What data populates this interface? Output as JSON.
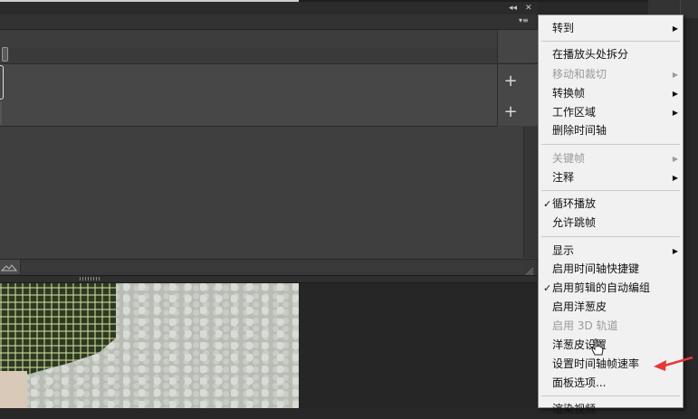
{
  "panel": {
    "header_icons": {
      "collapse": "double-chevron-icon",
      "close": "close-icon",
      "flyout": "panel-menu-icon"
    },
    "header_glyphs": {
      "collapse": "◂◂",
      "close": "✕",
      "flyout": "▾≡"
    },
    "tracks": [
      {
        "add_label": "+"
      },
      {
        "add_label": "+"
      }
    ]
  },
  "menu": {
    "items": [
      {
        "label": "转到",
        "submenu": true,
        "checked": false,
        "disabled": false
      },
      {
        "label": "在播放头处拆分",
        "submenu": false,
        "checked": false,
        "disabled": false
      },
      {
        "label": "移动和裁切",
        "submenu": true,
        "checked": false,
        "disabled": true
      },
      {
        "label": "转换帧",
        "submenu": true,
        "checked": false,
        "disabled": false
      },
      {
        "label": "工作区域",
        "submenu": true,
        "checked": false,
        "disabled": false
      },
      {
        "label": "删除时间轴",
        "submenu": false,
        "checked": false,
        "disabled": false
      },
      {
        "label": "关键帧",
        "submenu": true,
        "checked": false,
        "disabled": true
      },
      {
        "label": "注释",
        "submenu": true,
        "checked": false,
        "disabled": false
      },
      {
        "label": "循环播放",
        "submenu": false,
        "checked": true,
        "disabled": false
      },
      {
        "label": "允许跳帧",
        "submenu": false,
        "checked": false,
        "disabled": false
      },
      {
        "label": "显示",
        "submenu": true,
        "checked": false,
        "disabled": false
      },
      {
        "label": "启用时间轴快捷键",
        "submenu": false,
        "checked": false,
        "disabled": false
      },
      {
        "label": "启用剪辑的自动编组",
        "submenu": false,
        "checked": true,
        "disabled": false
      },
      {
        "label": "启用洋葱皮",
        "submenu": false,
        "checked": false,
        "disabled": false
      },
      {
        "label": "启用 3D 轨道",
        "submenu": false,
        "checked": false,
        "disabled": true
      },
      {
        "label": "洋葱皮设置",
        "submenu": false,
        "checked": false,
        "disabled": false
      },
      {
        "label": "设置时间轴帧速率",
        "submenu": false,
        "checked": false,
        "disabled": false
      },
      {
        "label": "面板选项...",
        "submenu": false,
        "checked": false,
        "disabled": false
      },
      {
        "label": "渲染视频",
        "submenu": false,
        "checked": false,
        "disabled": false
      }
    ],
    "check_glyph": "✓",
    "arrow_glyph": "▶"
  },
  "colors": {
    "annotation_arrow": "#e53935",
    "menu_bg": "#f1f1f1",
    "panel_bg": "#3c3c3c"
  }
}
